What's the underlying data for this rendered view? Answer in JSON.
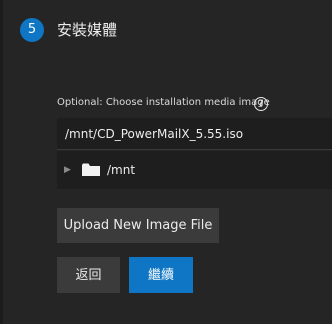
{
  "step": {
    "number": "5",
    "title": "安裝媒體"
  },
  "media": {
    "label": "Optional: Choose installation media image",
    "help_icon": "help-circle-icon",
    "path_value": "/mnt/CD_PowerMailX_5.55.iso"
  },
  "tree": {
    "arrow_icon": "triangle-right-icon",
    "folder_icon": "folder-icon",
    "root_label": "/mnt"
  },
  "buttons": {
    "upload_label": "Upload New Image File",
    "back_label": "返回",
    "next_label": "繼續"
  },
  "colors": {
    "accent": "#0e76c4",
    "background": "#252525",
    "field_background": "#1e1e1e",
    "button_gray": "#3b3b3b"
  }
}
